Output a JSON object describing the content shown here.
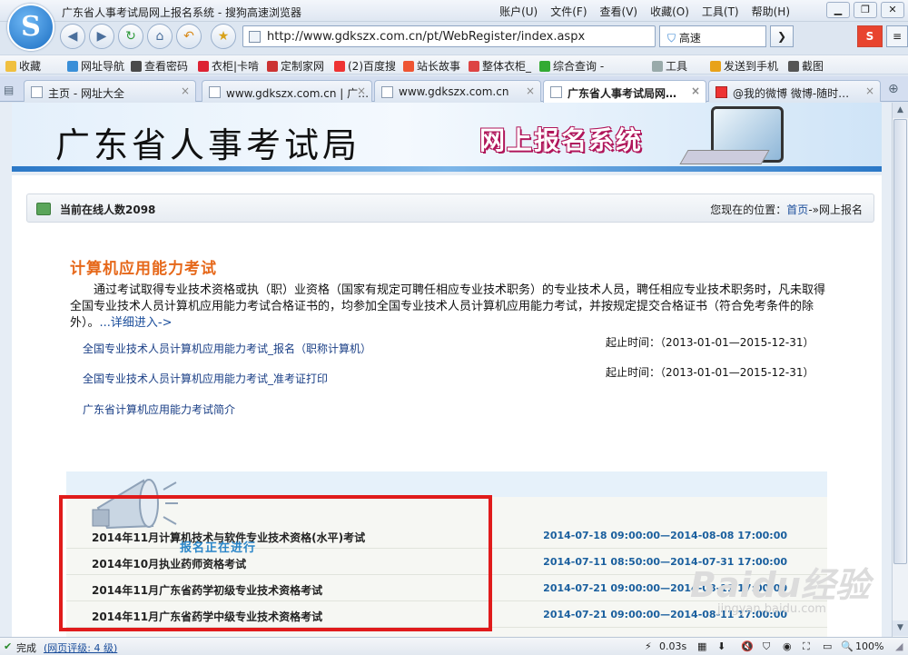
{
  "window": {
    "title": "广东省人事考试局网上报名系统 - 搜狗高速浏览器",
    "menus": [
      "账户(U)",
      "文件(F)",
      "查看(V)",
      "收藏(O)",
      "工具(T)",
      "帮助(H)"
    ],
    "logo_glyph": "S"
  },
  "nav": {
    "url": "http://www.gdkszx.com.cn/pt/WebRegister/index.aspx",
    "speed_label": "高速",
    "search_glyph": "S"
  },
  "favorites": [
    "收藏",
    "网址导航",
    "查看密码",
    "衣柜|卡啃",
    "定制家网",
    "(2)百度搜",
    "站长故事",
    "整体衣柜_",
    "综合查询 -",
    "工具",
    "发送到手机",
    "截图"
  ],
  "tabs": [
    {
      "label": "主页 - 网址大全",
      "active": false
    },
    {
      "label": "www.gdkszx.com.cn | 广…",
      "active": false
    },
    {
      "label": "www.gdkszx.com.cn",
      "active": false
    },
    {
      "label": "广东省人事考试局网…",
      "active": true
    },
    {
      "label": "@我的微博 微博-随时…",
      "active": false
    }
  ],
  "banner": {
    "org": "广东省人事考试局",
    "system": "网上报名系统"
  },
  "info": {
    "online": "当前在线人数2098",
    "location_prefix": "您现在的位置：",
    "location_home": "首页",
    "location_sep": "-»",
    "location_current": "网上报名"
  },
  "section": {
    "title": "计算机应用能力考试",
    "description": "通过考试取得专业技术资格或执（职）业资格（国家有规定可聘任相应专业技术职务）的专业技术人员，聘任相应专业技术职务时，凡未取得全国专业技术人员计算机应用能力考试合格证书的，均参加全国专业技术人员计算机应用能力考试，并按规定提交合格证书（符合免考条件的除外）。",
    "more": "...详细进入->",
    "links": [
      {
        "label": "全国专业技术人员计算机应用能力考试_报名（职称计算机）",
        "period": "起止时间：（2013-01-01—2015-12-31）"
      },
      {
        "label": "全国专业技术人员计算机应用能力考试_准考证打印",
        "period": "起止时间：（2013-01-01—2015-12-31）"
      },
      {
        "label": "广东省计算机应用能力考试简介",
        "period": ""
      }
    ]
  },
  "exams": {
    "status_note": "报名正在进行",
    "rows": [
      {
        "name": "2014年11月计算机技术与软件专业技术资格(水平)考试",
        "dates": "2014-07-18 09:00:00—2014-08-08 17:00:00"
      },
      {
        "name": "2014年10月执业药师资格考试",
        "dates": "2014-07-11 08:50:00—2014-07-31 17:00:00"
      },
      {
        "name": "2014年11月广东省药学初级专业技术资格考试",
        "dates": "2014-07-21 09:00:00—2014-08-11 17:00:00"
      },
      {
        "name": "2014年11月广东省药学中级专业技术资格考试",
        "dates": "2014-07-21 09:00:00—2014-08-11 17:00:00"
      }
    ]
  },
  "watermark": {
    "text": "Baidu经验",
    "sub": "jingyan.baidu.com"
  },
  "status": {
    "left": "完成",
    "rating": "(网页评级: 4 级)",
    "time": "0.03s",
    "zoom": "100%"
  },
  "colors": {
    "accent": "#1a4d9b",
    "section_title": "#e6681a",
    "highlight_box": "#e01b1b",
    "dates": "#1a5f9e"
  }
}
